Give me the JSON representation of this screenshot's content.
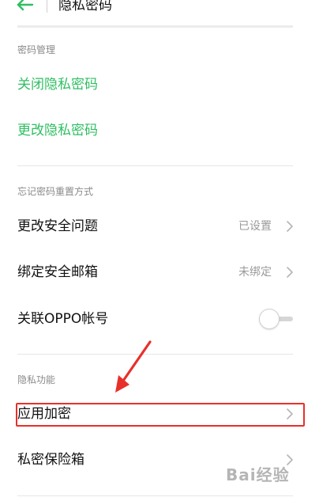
{
  "header": {
    "title": "隐私密码"
  },
  "sections": {
    "password_management": {
      "label": "密码管理",
      "close_password": "关闭隐私密码",
      "change_password": "更改隐私密码"
    },
    "forgot_reset": {
      "label": "忘记密码重置方式",
      "security_question": {
        "title": "更改安全问题",
        "value": "已设置"
      },
      "security_email": {
        "title": "绑定安全邮箱",
        "value": "未绑定"
      },
      "oppo_account": {
        "title": "关联OPPO帐号",
        "toggle_on": false
      }
    },
    "privacy_features": {
      "label": "隐私功能",
      "app_encryption": "应用加密",
      "private_safe": "私密保险箱"
    }
  },
  "watermark": {
    "text": "Bai经验"
  },
  "colors": {
    "accent_green": "#2fbf62",
    "highlight_red": "#e8302b",
    "secondary_text": "#9a9a9a"
  }
}
